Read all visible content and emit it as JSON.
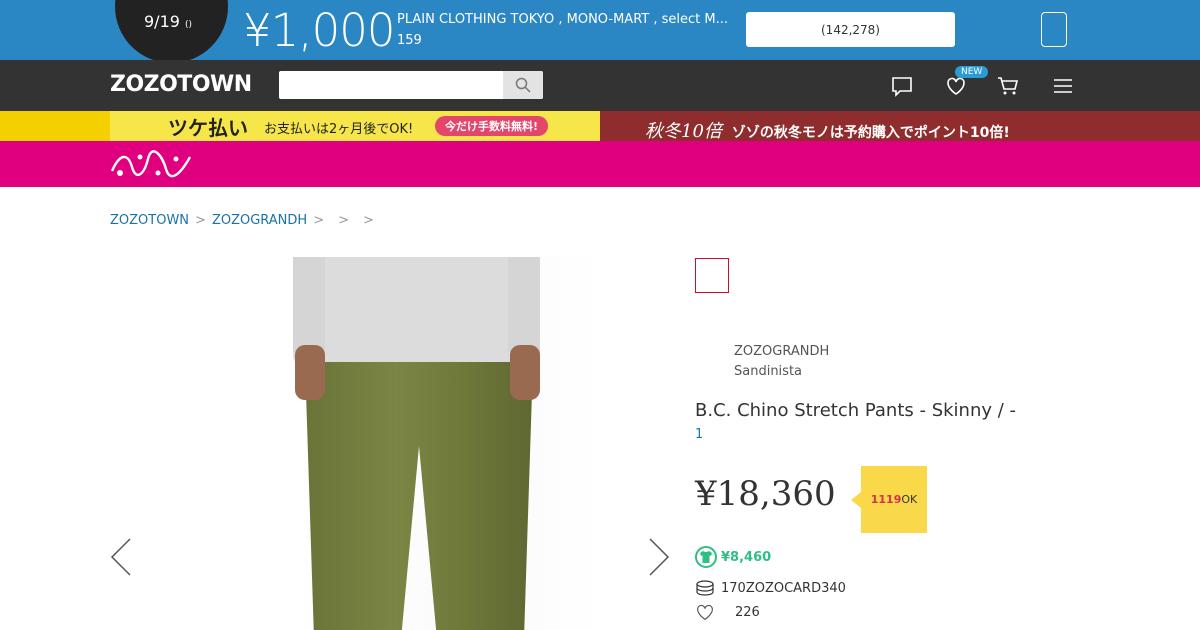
{
  "promo": {
    "date": "9/19",
    "date_suffix": "()",
    "amount": "¥1,000",
    "shops": "PLAIN CLOTHING TOKYO , MONO-MART , select M...",
    "shop_count": "159",
    "button_label": "(142,278)"
  },
  "header": {
    "logo": "ZOZOTOWN",
    "search_placeholder": "",
    "new_badge": "NEW"
  },
  "banner": {
    "left_big": "ツケ払い",
    "left_text": "お支払いは2ヶ月後でOK!",
    "left_pill": "今だけ手数料無料!",
    "right_lead": "秋冬10倍",
    "right_text": "ゾゾの秋冬モノは予約購入でポイント10倍!"
  },
  "breadcrumb": {
    "items": [
      "ZOZOTOWN",
      "ZOZOGRANDH"
    ],
    "seps": [
      ">",
      ">",
      ">",
      ">"
    ]
  },
  "product": {
    "brand": "ZOZOGRANDH",
    "sub_brand": "Sandinista",
    "title": "B.C. Chino Stretch Pants - Skinny /  -",
    "review_link": "1",
    "price": "¥18,360",
    "badge_num": "1119",
    "badge_suffix": "OK",
    "used_price": "¥8,460",
    "card_text": "170ZOZOCARD340",
    "favorites": "226"
  },
  "colors": {
    "promo_bg": "#2b87c4",
    "header_bg": "#333333",
    "brandbar_bg": "#e0007f",
    "link": "#1a73a8",
    "used_green": "#2fbf85",
    "badge_yellow": "#f9d94a"
  }
}
